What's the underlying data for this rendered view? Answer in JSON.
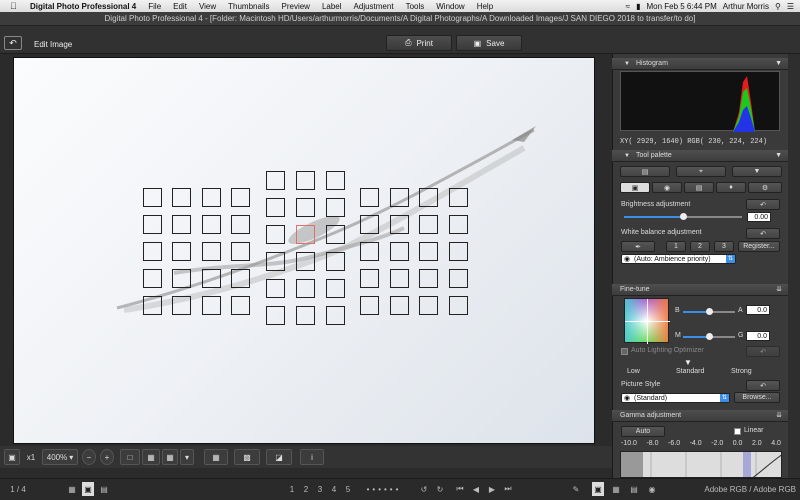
{
  "menubar": {
    "apple_icon": "apple-logo-icon",
    "app_name": "Digital Photo Professional 4",
    "menus": [
      "File",
      "Edit",
      "View",
      "Thumbnails",
      "Preview",
      "Label",
      "Adjustment",
      "Tools",
      "Window",
      "Help"
    ],
    "datetime": "Mon Feb 5  6:44 PM",
    "user": "Arthur Morris"
  },
  "window": {
    "title": "Digital Photo Professional 4 - [Folder: Macintosh HD/Users/arthurmorris/Documents/A Digital Photographs/A Downloaded Images/J SAN DIEGO 2018 to transfer/to do]"
  },
  "toolbar": {
    "back_icon": "return-arrow-icon",
    "mode_title": "Edit Image",
    "print_label": "Print",
    "save_label": "Save"
  },
  "histogram": {
    "header": "Histogram",
    "readout": "XY(  2929,  1640) RGB( 230, 224, 224)"
  },
  "tool_palette": {
    "header": "Tool palette",
    "brightness_label": "Brightness adjustment",
    "brightness_value": "0.00",
    "brightness_level": 0.5,
    "white_balance_label": "White balance adjustment",
    "wb_buttons": [
      "1",
      "2",
      "3",
      "Register..."
    ],
    "wb_select": "(Auto: Ambience priority)",
    "fine_tune_header": "Fine-tune",
    "fine_tune": {
      "b": "B",
      "a": "A",
      "a_value": "0.0",
      "m": "M",
      "g": "G",
      "g_value": "0.0"
    },
    "alo_label": "Auto Lighting Optimizer",
    "alo_levels": [
      "Low",
      "Standard",
      "Strong"
    ],
    "picture_style_label": "Picture Style",
    "picture_style_value": "(Standard)",
    "browse_label": "Browse...",
    "gamma_header": "Gamma adjustment",
    "gamma_auto": "Auto",
    "gamma_linear": "Linear",
    "gamma_ticks": [
      "-10.0",
      "-8.0",
      "-6.0",
      "-4.0",
      "-2.0",
      "0.0",
      "2.0",
      "4.0"
    ]
  },
  "viewer": {
    "zoom_label": "x1",
    "zoom_value": "400%"
  },
  "statusbar": {
    "page": "1 / 4",
    "color_space": "Adobe RGB / Adobe RGB",
    "labels": [
      "1",
      "2",
      "3",
      "4",
      "5"
    ]
  }
}
